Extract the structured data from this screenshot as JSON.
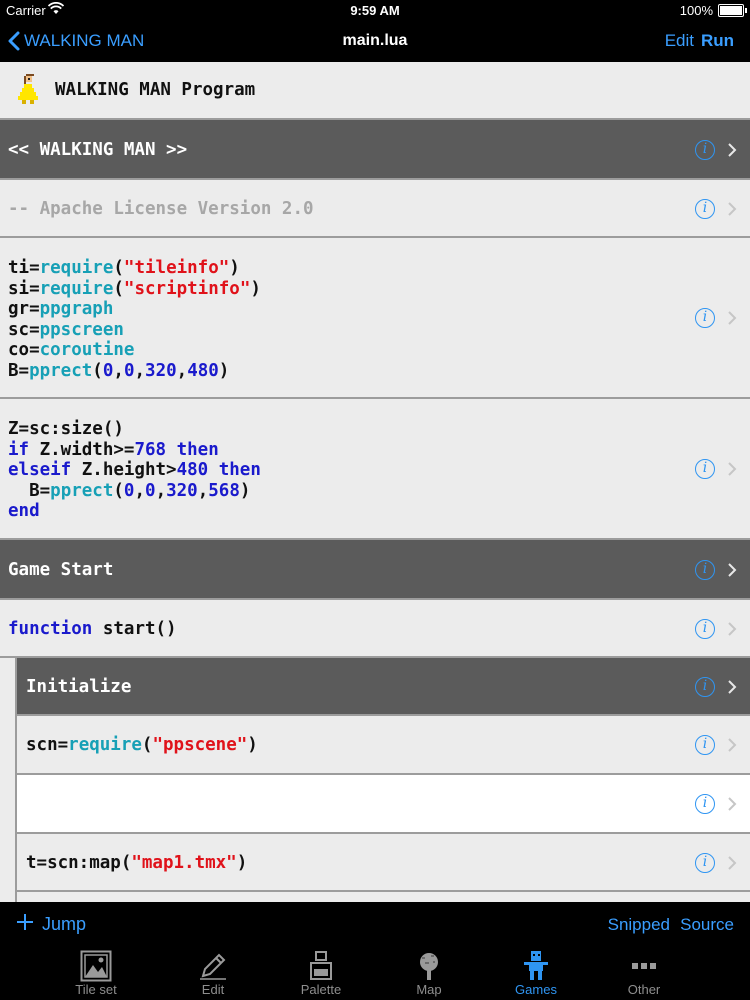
{
  "status_bar": {
    "carrier": "Carrier",
    "time": "9:59 AM",
    "battery": "100%"
  },
  "nav": {
    "back_label": "WALKING MAN",
    "title": "main.lua",
    "edit_label": "Edit",
    "run_label": "Run"
  },
  "rows": {
    "program_title": "WALKING MAN Program",
    "section_walking_man": "<< WALKING MAN >>",
    "license_comment": "-- Apache License Version 2.0",
    "game_start": "Game Start",
    "initialize": "Initialize"
  },
  "toolbar": {
    "jump_label": "Jump",
    "snipped_label": "Snipped",
    "source_label": "Source"
  },
  "tabs": [
    {
      "label": "Tile set",
      "icon": "tileset-icon"
    },
    {
      "label": "Edit",
      "icon": "pencil-icon"
    },
    {
      "label": "Palette",
      "icon": "ink-bottle-icon"
    },
    {
      "label": "Map",
      "icon": "map-icon"
    },
    {
      "label": "Games",
      "icon": "games-character-icon",
      "active": true
    },
    {
      "label": "Other",
      "icon": "more-icon"
    }
  ],
  "colors": {
    "accent": "#2f95f2",
    "header_bg": "#5b5b5b",
    "keyword": "#1a1acc",
    "function": "#17a0b6",
    "string": "#e0121a"
  }
}
